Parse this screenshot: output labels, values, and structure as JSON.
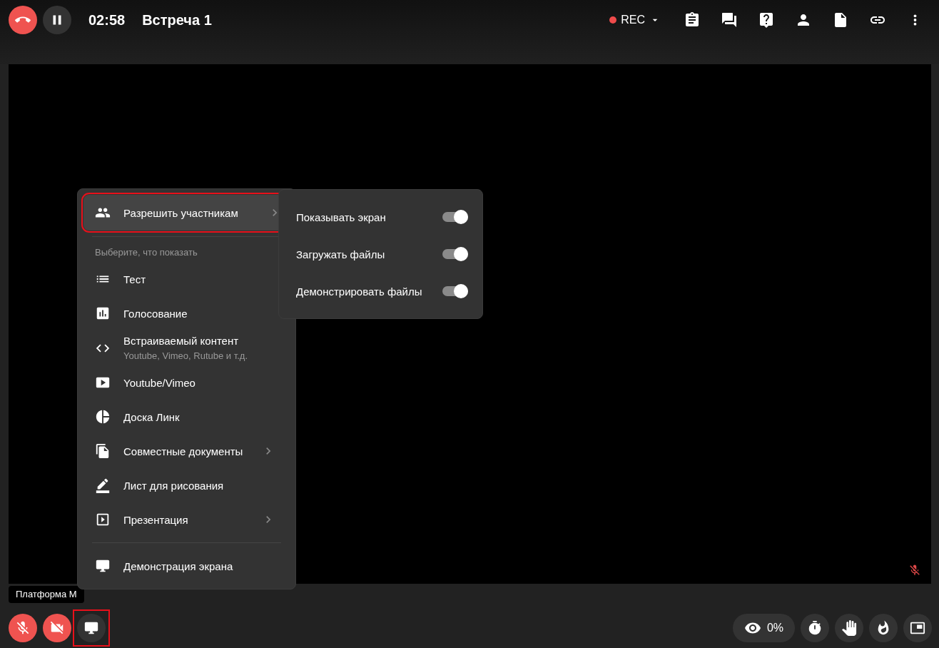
{
  "top_bar": {
    "timer": "02:58",
    "title": "Встреча 1",
    "rec_label": "REC"
  },
  "video": {
    "participant_name": "Платформа М",
    "muted": true
  },
  "share_menu": {
    "permissions_item": {
      "label": "Разрешить участникам",
      "active": true,
      "annotated": true
    },
    "section_label": "Выберите, что показать",
    "items": [
      {
        "label": "Тест",
        "has_submenu": false
      },
      {
        "label": "Голосование",
        "has_submenu": false
      },
      {
        "label": "Встраиваемый контент",
        "sublabel": "Youtube, Vimeo, Rutube и т.д.",
        "has_submenu": false
      },
      {
        "label": "Youtube/Vimeo",
        "has_submenu": false
      },
      {
        "label": "Доска Линк",
        "has_submenu": false
      },
      {
        "label": "Совместные документы",
        "has_submenu": true
      },
      {
        "label": "Лист для рисования",
        "has_submenu": false
      },
      {
        "label": "Презентация",
        "has_submenu": true
      }
    ],
    "footer_item": {
      "label": "Демонстрация экрана"
    }
  },
  "permissions_submenu": {
    "toggles": [
      {
        "label": "Показывать экран",
        "on": true
      },
      {
        "label": "Загружать файлы",
        "on": true
      },
      {
        "label": "Демонстрировать файлы",
        "on": true
      }
    ]
  },
  "bottom_bar": {
    "mic_muted": true,
    "camera_off": true,
    "screen_share_annotated": true,
    "attention": "0%"
  }
}
